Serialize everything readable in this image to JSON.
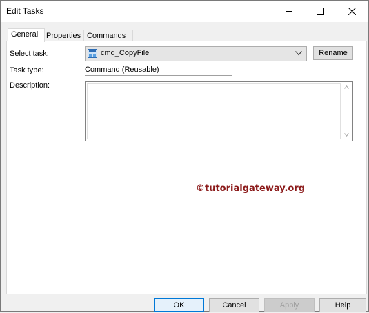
{
  "window": {
    "title": "Edit Tasks"
  },
  "tabs": [
    {
      "label": "General",
      "active": true
    },
    {
      "label": "Properties",
      "active": false
    },
    {
      "label": "Commands",
      "active": false
    }
  ],
  "general": {
    "select_task_label": "Select task:",
    "select_task_value": "cmd_CopyFile",
    "rename_label": "Rename",
    "task_type_label": "Task type:",
    "task_type_value": "Command (Reusable)",
    "description_label": "Description:",
    "description_value": ""
  },
  "watermark": "©tutorialgateway.org",
  "footer": {
    "ok": "OK",
    "cancel": "Cancel",
    "apply": "Apply",
    "help": "Help"
  },
  "colors": {
    "watermark": "#8b1a1a",
    "focus_border": "#0078d7"
  },
  "icons": {
    "task_icon": "command-task-icon",
    "dropdown": "chevron-down-icon"
  }
}
